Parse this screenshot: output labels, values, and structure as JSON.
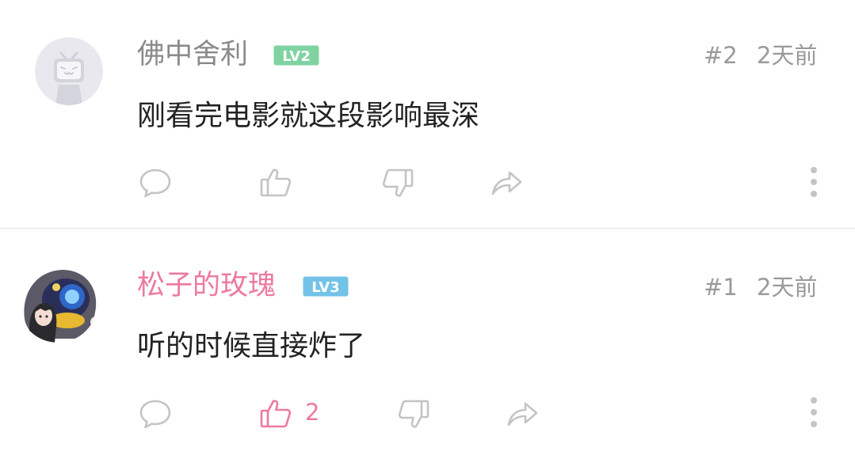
{
  "comments": [
    {
      "username": "佛中舍利",
      "level": "LV2",
      "floor": "#2",
      "time": "2天前",
      "content": "刚看完电影就这段影响最深",
      "likes": "",
      "liked": false,
      "avatar_icon": "tv-mascot-icon"
    },
    {
      "username": "松子的玫瑰",
      "level": "LV3",
      "floor": "#1",
      "time": "2天前",
      "content": "听的时候直接炸了",
      "likes": "2",
      "liked": true,
      "avatar_icon": "anime-avatar-image"
    }
  ],
  "colors": {
    "username_default": "#8a8a8a",
    "username_vip": "#ec7aa0",
    "accent_pink": "#ec7aa0",
    "level_lv2": "#7fd3a0",
    "level_lv3": "#73c3e8",
    "icon_gray": "#c4c4c4",
    "meta_gray": "#9a9a9a"
  }
}
